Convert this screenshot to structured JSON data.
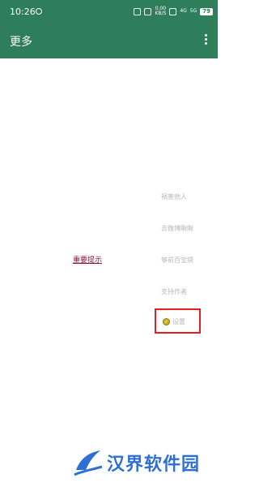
{
  "status_bar": {
    "time": "10:26",
    "speed_top": "0.00",
    "speed_bottom": "KB/S",
    "net1": "4G",
    "net2": "5G",
    "battery": "79"
  },
  "app_bar": {
    "title": "更多"
  },
  "content": {
    "tip_link": "重要提示"
  },
  "menu": {
    "items": [
      {
        "label": "祸害他人"
      },
      {
        "label": "去微博瞅瞅"
      },
      {
        "label": "够前百宝袋"
      },
      {
        "label": "支持作者"
      },
      {
        "label": "设置",
        "icon": "settings-icon"
      }
    ]
  },
  "watermark": {
    "text": "汉界软件园",
    "color": "#2e6fd6"
  },
  "colors": {
    "primary": "#2e7d5b",
    "tip": "#8a1538",
    "highlight": "#e02020",
    "menu_text": "#b8b8b8"
  }
}
